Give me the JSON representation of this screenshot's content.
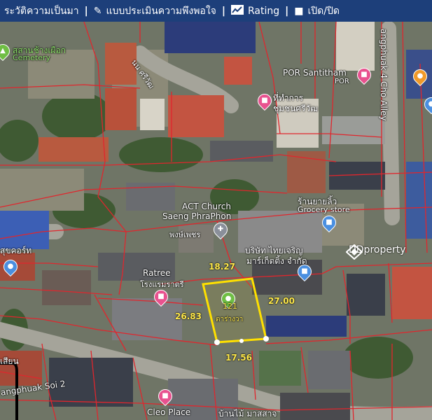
{
  "topbar": {
    "items": [
      {
        "label": "ระวัติความเป็นมา",
        "icon": ""
      },
      {
        "label": "แบบประเมินความพึงพอใจ",
        "icon": "edit-icon"
      },
      {
        "label": "Rating",
        "icon": "chart-icon"
      },
      {
        "label": "เปิด/ปิด",
        "icon": "square-icon"
      }
    ]
  },
  "map": {
    "labels": {
      "cemetery_th": "สุสานช้างเผือก",
      "cemetery_en": "Cemetery",
      "road_north": "นน ศรีวัฒ",
      "alley": "angphuak 4 Cho Alley",
      "por_santitham": "POR Santitham",
      "por_sub": "POR",
      "office_th1": "ที่ทำการ",
      "office_th2": "ชุมชนศรีวัฒ",
      "grocery_th": "ร้านยายลิ้ว",
      "grocery_en": "Grocery store",
      "church_en1": "ACT Church",
      "church_en2": "Saeng PhraPhon",
      "church_th": "พงษ์เพชร",
      "company_th1": "บริษัท ไทยเจริญ",
      "company_th2": "มาร์เก็ตติ้ง จำกัด",
      "ratree_en": "Ratree",
      "ratree_th": "โรงแรมราตรี",
      "left_th": "สุขคอร์ท",
      "bottom_left_th": "เสียน",
      "soi2": "angphuak Soi 2",
      "cleo": "Cleo Place",
      "bottom_right_th": "บ้านไม้ มาสสาจ"
    },
    "dims": {
      "top": "18.27",
      "left": "26.83",
      "right": "27.00",
      "bottom": "17.56",
      "plot_no": "121",
      "plot_name": "ตาร่างวา"
    }
  },
  "watermark": "DDproperty",
  "colors": {
    "topbar": "#1d3f7a",
    "parcel_line": "#e0262d",
    "plot_outline": "#ffe000",
    "pin_green": "#6fbe44",
    "pin_pink": "#e8528f",
    "pin_blue": "#4a8fe0",
    "pin_orange": "#f09a2a"
  }
}
